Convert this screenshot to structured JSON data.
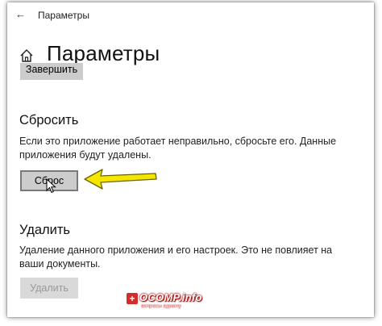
{
  "window": {
    "title": "Параметры",
    "back_icon": "back-arrow-icon"
  },
  "header": {
    "home_icon": "home-icon",
    "title": "Параметры"
  },
  "terminate": {
    "button_label": "Завершить"
  },
  "reset": {
    "title": "Сбросить",
    "description_line1": "Если это приложение работает неправильно, сбросьте его. Данные",
    "description_line2": "приложения будут удалены.",
    "button_label": "Сброс"
  },
  "uninstall": {
    "title": "Удалить",
    "description_line1": "Удаление данного приложения и его настроек. Это не повлияет на",
    "description_line2": "ваши документы.",
    "button_label": "Удалить",
    "button_disabled": true
  },
  "annotation": {
    "arrow_color": "#f5e600",
    "arrow_outline": "#6b6200"
  },
  "watermark": {
    "badge": "+",
    "logo": "OCOMP.info",
    "subtitle": "вопросы админу"
  }
}
